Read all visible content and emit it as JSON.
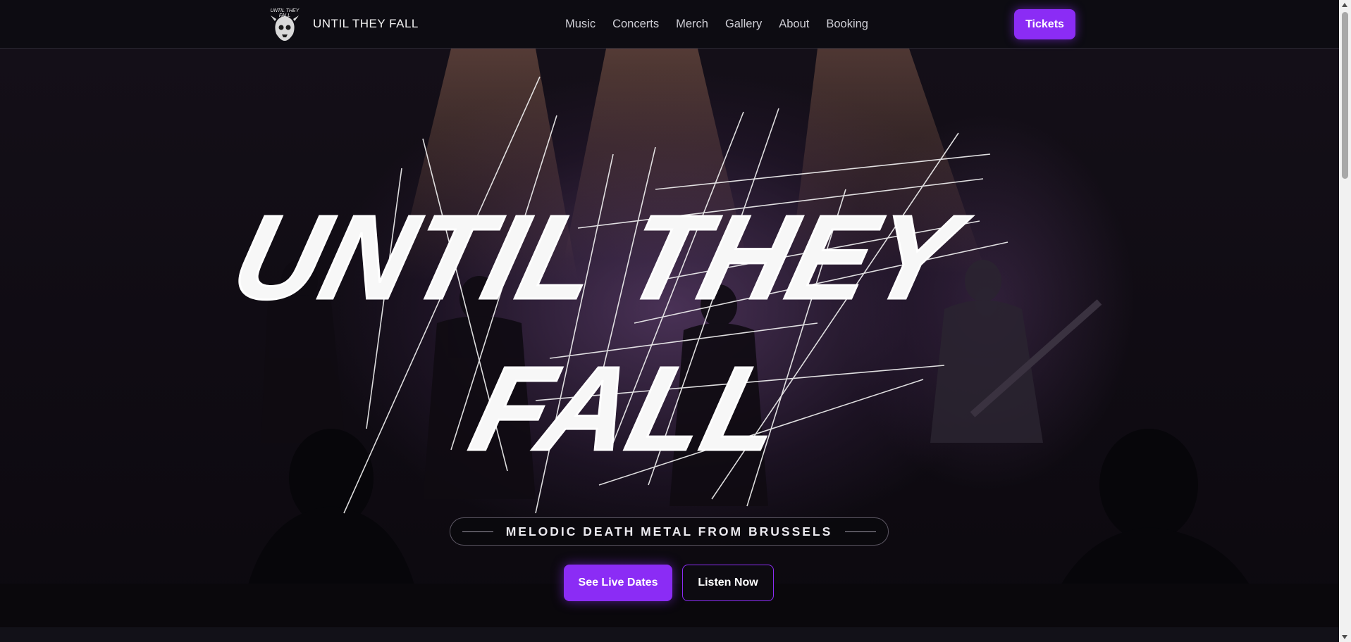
{
  "navbar": {
    "brand_name": "UNTIL THEY FALL",
    "logo_text": "UNTIL THEY FALL",
    "links": [
      "Music",
      "Concerts",
      "Merch",
      "Gallery",
      "About",
      "Booking"
    ],
    "tickets_label": "Tickets"
  },
  "hero": {
    "title_line1": "UNTIL THEY",
    "title_line2": "FALL",
    "tagline": "MELODIC DEATH METAL FROM BRUSSELS",
    "primary_cta": "See Live Dates",
    "secondary_cta": "Listen Now"
  },
  "colors": {
    "accent": "#8b2cf5",
    "background": "#0b0a10"
  }
}
